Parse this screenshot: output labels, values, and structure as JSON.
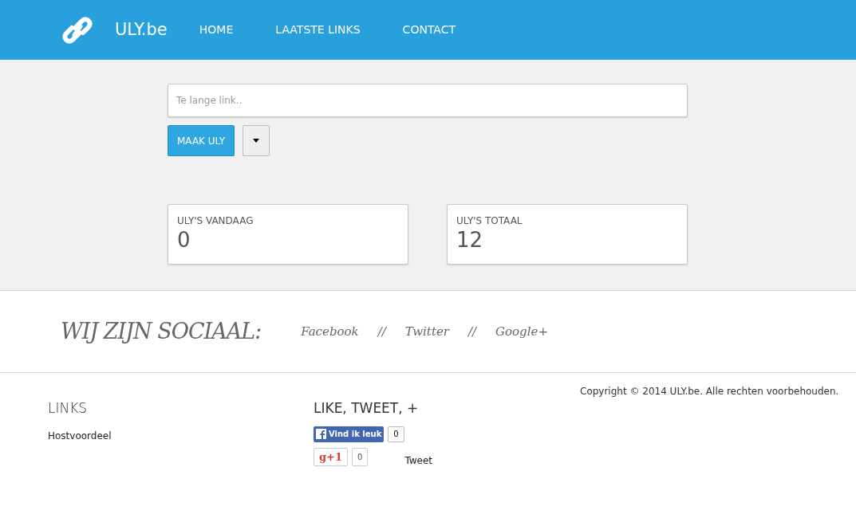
{
  "brand": "ULY.be",
  "nav": [
    {
      "label": "HOME"
    },
    {
      "label": "LAATSTE LINKS"
    },
    {
      "label": "CONTACT"
    }
  ],
  "form": {
    "placeholder": "Te lange link..",
    "submit": "MAAK ULY"
  },
  "stats": [
    {
      "label": "ULY'S VANDAAG",
      "value": "0"
    },
    {
      "label": "ULY'S TOTAAL",
      "value": "12"
    }
  ],
  "social": {
    "title": "WIJ ZIJN SOCIAAL:",
    "links": [
      "Facebook",
      "Twitter",
      "Google+"
    ],
    "separator": "//"
  },
  "footer": {
    "links_title": "LINKS",
    "links": [
      "Hostvoordeel"
    ],
    "share_title": "LIKE, TWEET, +",
    "facebook": {
      "label": "Vind ik leuk",
      "count": "0"
    },
    "gplus": {
      "label": "g+1",
      "count": "0"
    },
    "tweet": "Tweet",
    "copyright": "Copyright © 2014 ULY.be. Alle rechten voorbehouden."
  }
}
